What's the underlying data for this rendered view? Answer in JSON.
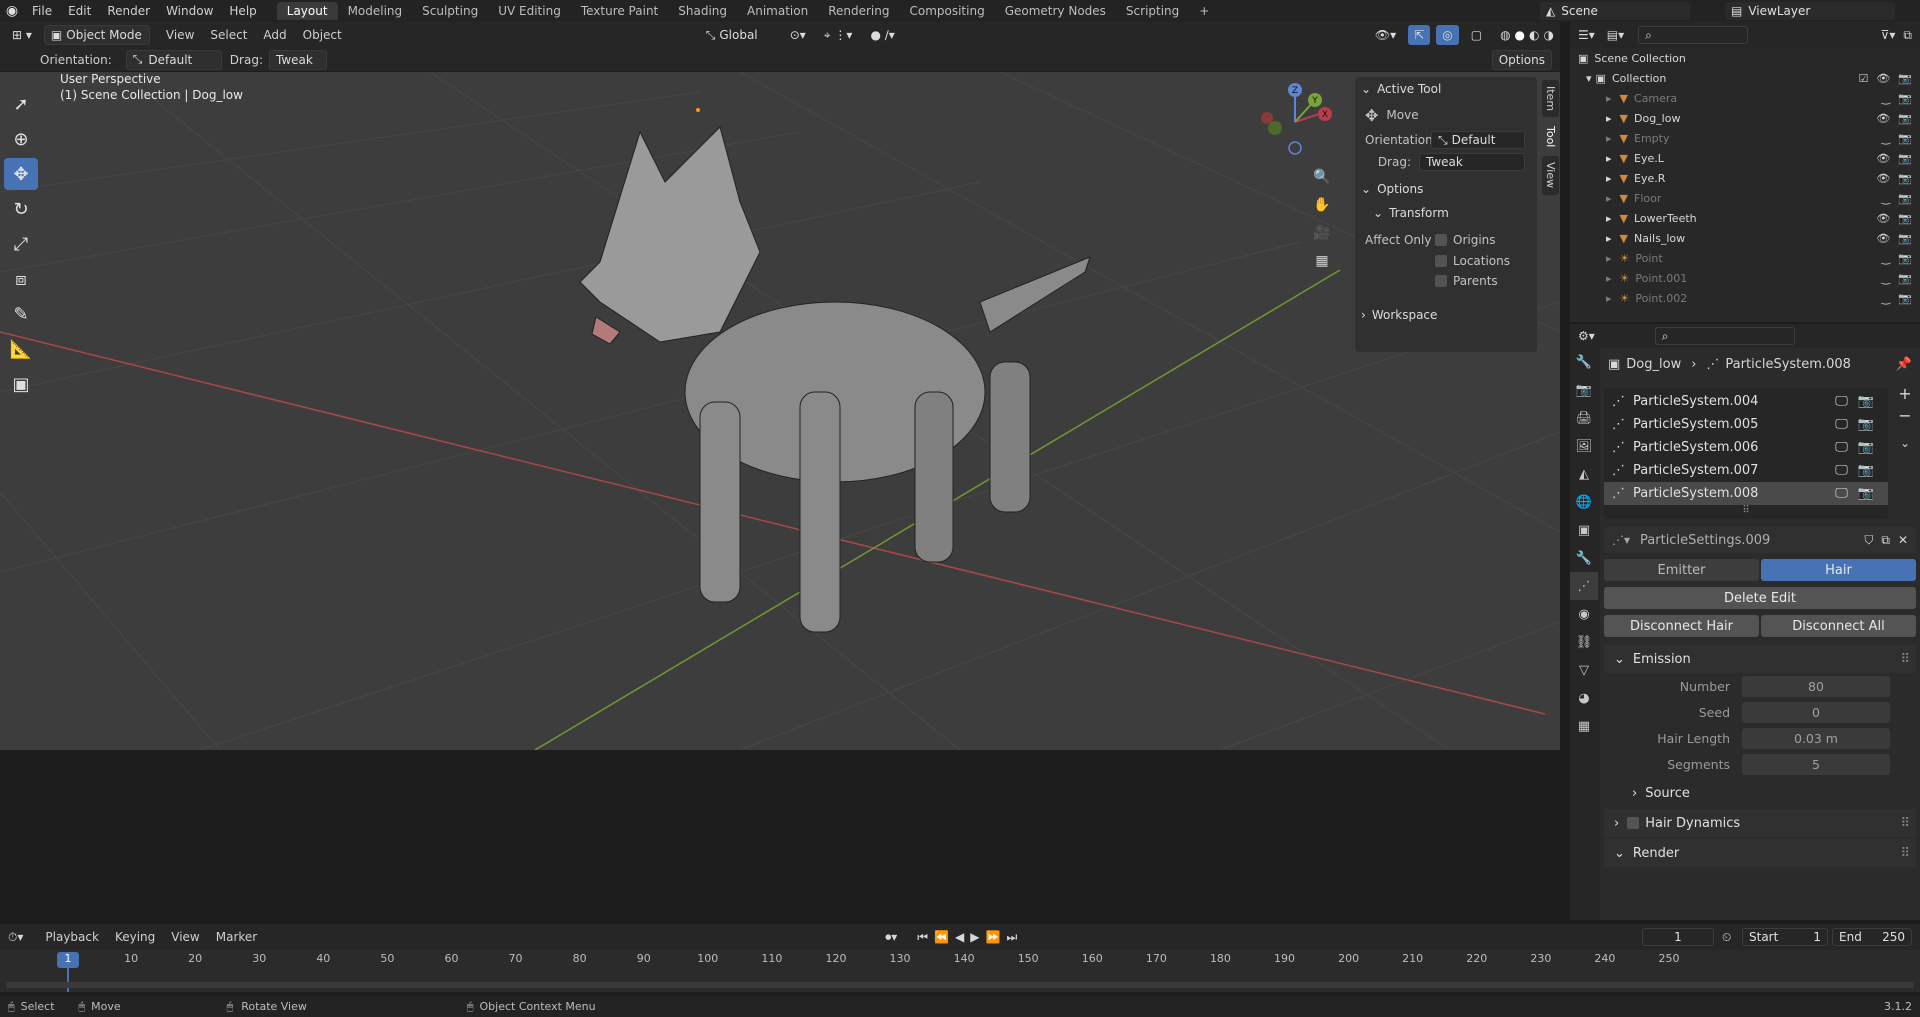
{
  "topbar": {
    "menus": [
      "File",
      "Edit",
      "Render",
      "Window",
      "Help"
    ],
    "workspaces": [
      "Layout",
      "Modeling",
      "Sculpting",
      "UV Editing",
      "Texture Paint",
      "Shading",
      "Animation",
      "Rendering",
      "Compositing",
      "Geometry Nodes",
      "Scripting"
    ],
    "active_workspace": "Layout",
    "add_tab": "+",
    "scene": "Scene",
    "view_layer": "ViewLayer"
  },
  "viewport_header": {
    "mode": "Object Mode",
    "menus": [
      "View",
      "Select",
      "Add",
      "Object"
    ],
    "transform_orientation": "Global"
  },
  "tool_header": {
    "orientation_label": "Orientation:",
    "orientation_value": "Default",
    "drag_label": "Drag:",
    "drag_value": "Tweak",
    "options": "Options"
  },
  "viewport": {
    "perspective": "User Perspective",
    "collection_info": "(1) Scene Collection | Dog_low",
    "gizmo_axes": [
      "Z",
      "Y",
      "X"
    ]
  },
  "npanel": {
    "tabs": [
      "Item",
      "Tool",
      "View"
    ],
    "active_tab": "Tool",
    "active_tool_header": "Active Tool",
    "tool_name": "Move",
    "orientation_label": "Orientation",
    "orientation_value": "Default",
    "drag_label": "Drag:",
    "drag_value": "Tweak",
    "options_header": "Options",
    "transform_header": "Transform",
    "affect_only_label": "Affect Only",
    "affect_only": [
      "Origins",
      "Locations",
      "Parents"
    ],
    "workspace_header": "Workspace"
  },
  "outliner": {
    "scene_collection": "Scene Collection",
    "collection": "Collection",
    "items": [
      {
        "name": "Camera",
        "dim": true
      },
      {
        "name": "Dog_low",
        "dim": false
      },
      {
        "name": "Empty",
        "dim": true
      },
      {
        "name": "Eye.L",
        "dim": false
      },
      {
        "name": "Eye.R",
        "dim": false
      },
      {
        "name": "Floor",
        "dim": true
      },
      {
        "name": "LowerTeeth",
        "dim": false
      },
      {
        "name": "Nails_low",
        "dim": false
      },
      {
        "name": "Point",
        "dim": true
      },
      {
        "name": "Point.001",
        "dim": true
      },
      {
        "name": "Point.002",
        "dim": true
      }
    ]
  },
  "properties": {
    "object": "Dog_low",
    "particle_system": "ParticleSystem.008",
    "systems": [
      "ParticleSystem.004",
      "ParticleSystem.005",
      "ParticleSystem.006",
      "ParticleSystem.007",
      "ParticleSystem.008"
    ],
    "selected_system": "ParticleSystem.008",
    "settings": "ParticleSettings.009",
    "type_options": [
      "Emitter",
      "Hair"
    ],
    "active_type": "Hair",
    "delete_edit": "Delete Edit",
    "disconnect_hair": "Disconnect Hair",
    "disconnect_all": "Disconnect All",
    "emission_header": "Emission",
    "fields": [
      {
        "label": "Number",
        "value": "80"
      },
      {
        "label": "Seed",
        "value": "0"
      },
      {
        "label": "Hair Length",
        "value": "0.03 m"
      },
      {
        "label": "Segments",
        "value": "5"
      }
    ],
    "source_header": "Source",
    "hair_dynamics_header": "Hair Dynamics",
    "render_header": "Render"
  },
  "timeline": {
    "menus": [
      "Playback",
      "Keying",
      "View",
      "Marker"
    ],
    "current_frame": "1",
    "start_label": "Start",
    "start_value": "1",
    "end_label": "End",
    "end_value": "250",
    "ruler": [
      "10",
      "20",
      "30",
      "40",
      "50",
      "60",
      "70",
      "80",
      "90",
      "100",
      "110",
      "120",
      "130",
      "140",
      "150",
      "160",
      "170",
      "180",
      "190",
      "200",
      "210",
      "220",
      "230",
      "240",
      "250"
    ]
  },
  "status": {
    "select": "Select",
    "move": "Move",
    "rotate": "Rotate View",
    "context": "Object Context Menu",
    "version": "3.1.2"
  }
}
